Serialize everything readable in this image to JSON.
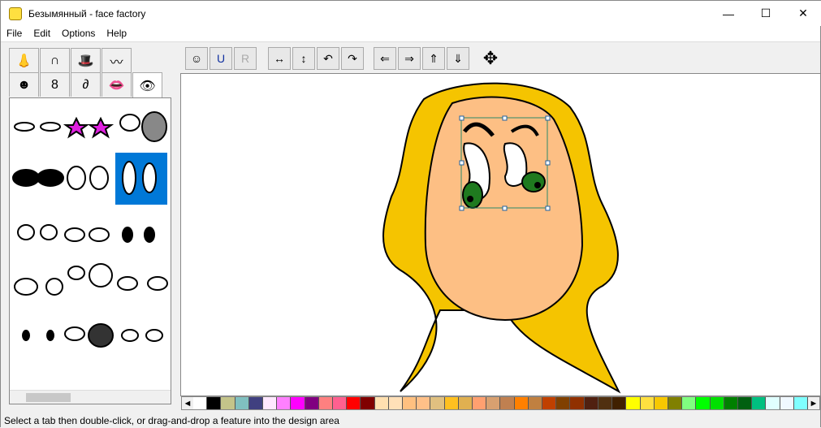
{
  "window": {
    "title": "Безымянный - face factory",
    "minimize": "—",
    "maximize": "☐",
    "close": "✕"
  },
  "menu": [
    "File",
    "Edit",
    "Options",
    "Help"
  ],
  "tabs": [
    {
      "name": "nose",
      "glyph": "👃"
    },
    {
      "name": "hair",
      "glyph": "∩"
    },
    {
      "name": "hat",
      "glyph": "🎩"
    },
    {
      "name": "moustache",
      "glyph": "〰"
    },
    {
      "name": "face",
      "glyph": "☻"
    },
    {
      "name": "head-shape",
      "glyph": "8"
    },
    {
      "name": "ear",
      "glyph": "∂"
    },
    {
      "name": "lips",
      "glyph": "👄"
    },
    {
      "name": "eyes",
      "glyph": "👁"
    }
  ],
  "toolbar": [
    {
      "name": "new-face",
      "glyph": "☺"
    },
    {
      "name": "undo",
      "glyph": "U"
    },
    {
      "name": "redo",
      "glyph": "R"
    },
    {
      "name": "widen",
      "glyph": "↔"
    },
    {
      "name": "stretch",
      "glyph": "↕"
    },
    {
      "name": "rotate-left",
      "glyph": "↶"
    },
    {
      "name": "rotate-right",
      "glyph": "↷"
    },
    {
      "name": "skew-left",
      "glyph": "⇐"
    },
    {
      "name": "skew-right",
      "glyph": "⇒"
    },
    {
      "name": "skew-up",
      "glyph": "⇑"
    },
    {
      "name": "skew-down",
      "glyph": "⇓"
    },
    {
      "name": "move",
      "glyph": "✥"
    }
  ],
  "palette": {
    "colors": [
      "#ffffff",
      "#000000",
      "#c4c48a",
      "#80c0c0",
      "#404080",
      "#ffe8ff",
      "#ff80ff",
      "#ff00ff",
      "#800080",
      "#ff8080",
      "#ff6090",
      "#ff0000",
      "#800000",
      "#ffe0b0",
      "#ffe0b8",
      "#ffc080",
      "#ffc088",
      "#e0c080",
      "#ffc020",
      "#e0b050",
      "#ffa070",
      "#d8a070",
      "#c08050",
      "#ff8000",
      "#c08040",
      "#c04000",
      "#804000",
      "#903000",
      "#502010",
      "#503010",
      "#402000",
      "#ffff00",
      "#ffe040",
      "#f8c800",
      "#808000",
      "#80ff80",
      "#00ff00",
      "#00e000",
      "#008000",
      "#006010",
      "#00c080",
      "#e0ffff",
      "#f0f8ff",
      "#80ffff"
    ],
    "left": "◄",
    "right": "►"
  },
  "status": "Select a tab then double-click, or drag-and-drop a feature into the design area",
  "colors": {
    "hair": "#f5c400",
    "skin": "#fdbf84",
    "iris": "#1f7a1f",
    "selection": "#0078d7"
  }
}
